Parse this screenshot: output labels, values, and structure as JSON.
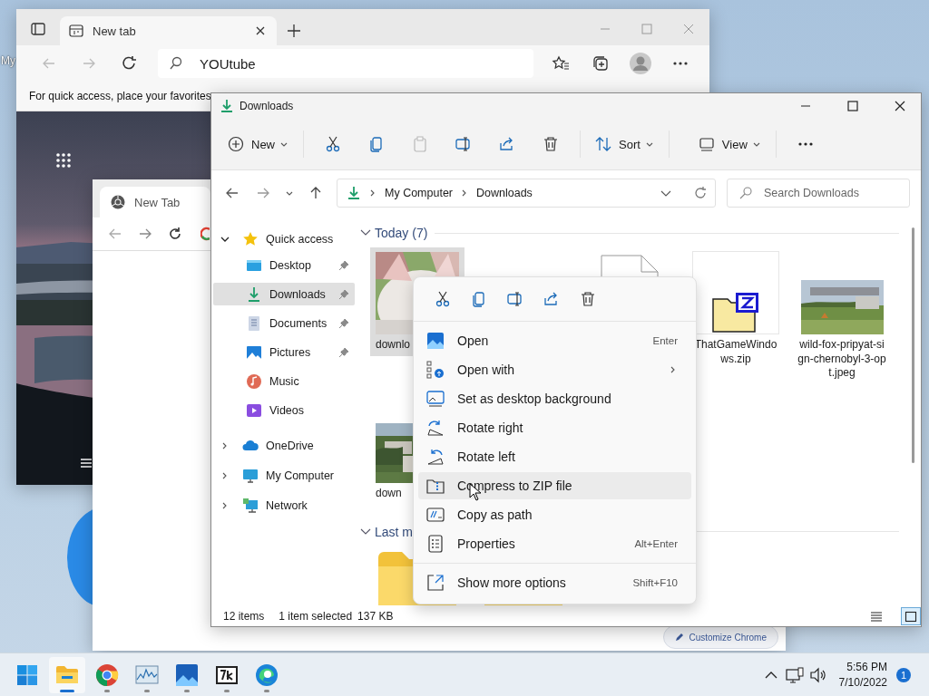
{
  "desktop": {
    "icon_label": "My"
  },
  "edge": {
    "tab_title": "New tab",
    "address": "YOUtube",
    "favorites_hint": "For quick access, place your favorites"
  },
  "chrome": {
    "tab_title": "New Tab",
    "customize_button": "Customize Chrome"
  },
  "explorer": {
    "title": "Downloads",
    "commands": [
      {
        "kind": "dropdown",
        "label": "New"
      },
      {
        "kind": "icon",
        "disabled": false
      },
      {
        "kind": "icon",
        "disabled": false
      },
      {
        "kind": "icon",
        "disabled": true
      },
      {
        "kind": "icon",
        "disabled": false
      },
      {
        "kind": "icon",
        "disabled": false
      },
      {
        "kind": "icon",
        "disabled": false
      },
      {
        "kind": "dropdown",
        "label": "Sort"
      },
      {
        "kind": "dropdown",
        "label": "View"
      },
      {
        "kind": "more"
      }
    ],
    "breadcrumbs": [
      "My Computer",
      "Downloads"
    ],
    "search": {
      "placeholder": "Search Downloads"
    },
    "nav": [
      {
        "label": "Quick access",
        "expanded": true,
        "selected": false,
        "children": [
          {
            "label": "Desktop",
            "pinned": true,
            "selected": false
          },
          {
            "label": "Downloads",
            "pinned": true,
            "selected": true
          },
          {
            "label": "Documents",
            "pinned": true,
            "selected": false
          },
          {
            "label": "Pictures",
            "pinned": true,
            "selected": false
          },
          {
            "label": "Music",
            "pinned": false,
            "selected": false
          },
          {
            "label": "Videos",
            "pinned": false,
            "selected": false
          }
        ]
      },
      {
        "label": "OneDrive",
        "expanded": false,
        "selected": false
      },
      {
        "label": "My Computer",
        "expanded": false,
        "selected": false
      },
      {
        "label": "Network",
        "expanded": false,
        "selected": false
      }
    ],
    "groups": [
      {
        "title": "Today (7)",
        "expanded": true,
        "files": [
          {
            "kind": "cat-photo",
            "name": "downlo",
            "selected": true
          },
          {
            "kind": "document",
            "selected": false
          },
          {
            "kind": "zip",
            "name": "ThatGameWindows.zip",
            "selected": false
          },
          {
            "kind": "sign-photo",
            "name": "wild-fox-pripyat-sign-chernobyl-3-opt.jpeg",
            "selected": false
          },
          {
            "kind": "town-photo",
            "name": "down",
            "selected": false
          }
        ]
      },
      {
        "title": "Last m",
        "expanded": true,
        "files": [
          {
            "kind": "folder",
            "selected": false
          },
          {
            "kind": "folder",
            "selected": false
          }
        ]
      }
    ],
    "status": {
      "count": "12 items",
      "selection": "1 item selected",
      "size": "137 KB"
    },
    "views": [
      {
        "selected": false
      },
      {
        "selected": true
      }
    ]
  },
  "context_menu": {
    "items": [
      {
        "label": "Open",
        "shortcut": "Enter",
        "submenu": false,
        "hovered": false
      },
      {
        "label": "Open with",
        "submenu": true,
        "hovered": false
      },
      {
        "label": "Set as desktop background",
        "submenu": false,
        "hovered": false
      },
      {
        "label": "Rotate right",
        "submenu": false,
        "hovered": false
      },
      {
        "label": "Rotate left",
        "submenu": false,
        "hovered": false
      },
      {
        "label": "Compress to ZIP file",
        "submenu": false,
        "hovered": true
      },
      {
        "label": "Copy as path",
        "submenu": false,
        "hovered": false
      },
      {
        "label": "Properties",
        "shortcut": "Alt+Enter",
        "submenu": false,
        "hovered": false
      }
    ],
    "footer": {
      "label": "Show more options",
      "shortcut": "Shift+F10"
    }
  },
  "taskbar": {
    "apps": [
      {
        "active": true
      },
      {
        "active": false
      },
      {
        "active": false
      },
      {
        "active": false
      },
      {
        "active": false
      },
      {
        "active": false
      }
    ],
    "time": "5:56 PM",
    "date": "7/10/2022",
    "notifications": "1"
  }
}
